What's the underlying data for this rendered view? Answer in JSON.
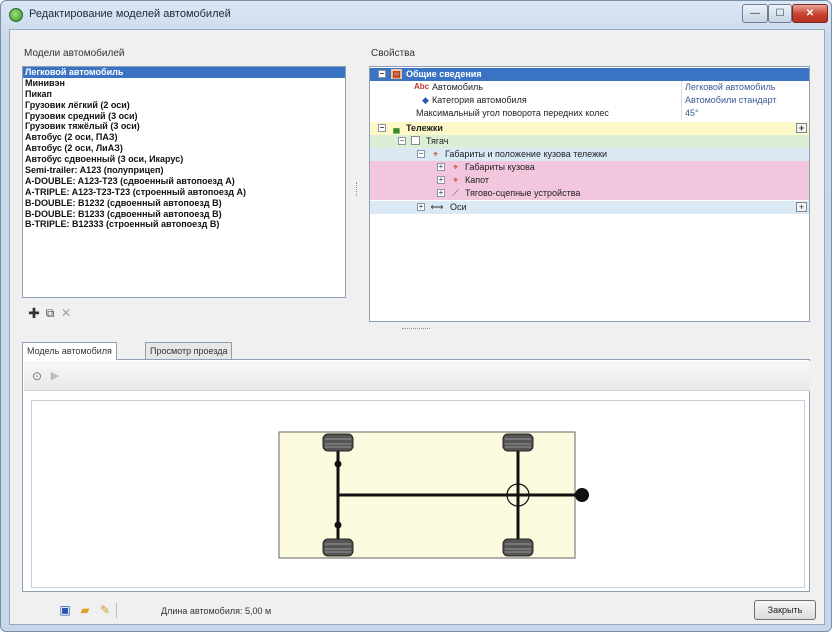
{
  "window": {
    "title": "Редактирование моделей автомобилей",
    "min_glyph": "—",
    "max_glyph": "☐",
    "close_glyph": "✕"
  },
  "models": {
    "label": "Модели автомобилей",
    "items": [
      "Легковой автомобиль",
      "Минивэн",
      "Пикап",
      "Грузовик лёгкий (2 оси)",
      "Грузовик средний (3 оси)",
      "Грузовик тяжёлый (3 оси)",
      "Автобус (2 оси, ПАЗ)",
      "Автобус (2 оси, ЛиАЗ)",
      "Автобус сдвоенный (3 оси, Икарус)",
      "Semi-trailer: A123 (полуприцеп)",
      "A-DOUBLE: A123-T23 (сдвоенный автопоезд А)",
      "A-TRIPLE: A123-T23-T23 (строенный автопоезд А)",
      "B-DOUBLE: B1232 (сдвоенный автопоезд В)",
      "B-DOUBLE: B1233 (сдвоенный автопоезд В)",
      "B-TRIPLE: B12333 (строенный автопоезд В)"
    ],
    "selected_index": 0
  },
  "properties": {
    "label": "Свойства",
    "general_header": "Общие сведения",
    "car_label": "Автомобиль",
    "car_value": "Легковой автомобиль",
    "category_label": "Категория автомобиля",
    "category_value": "Автомобили стандарт",
    "max_angle_label": "Максимальный угол поворота передних колес",
    "max_angle_value": "45°",
    "carts_header": "Тележки",
    "tractor_label": "Тягач",
    "dimensions_label": "Габариты и положение кузова тележки",
    "body_dims_label": "Габариты кузова",
    "hood_label": "Капот",
    "coupling_label": "Тягово-сцепные устройства",
    "axles_label": "Оси",
    "expanded_glyph": "−",
    "collapsed_glyph": "+"
  },
  "tabs": [
    "Модель автомобиля",
    "Просмотр проезда"
  ],
  "status": {
    "length_text": "Длина автомобиля: 5,00 м"
  },
  "buttons": {
    "close_label": "Закрыть"
  },
  "colors": {
    "selection": "#3b73c4",
    "general_header": "#3b73c4",
    "carts_row": "#fdf8c8",
    "tractor_row": "#dcefd6",
    "dimensions_row": "#dbe9f5",
    "pink_row": "#f2c6dd",
    "drawing_bg": "#fcfbdf"
  }
}
